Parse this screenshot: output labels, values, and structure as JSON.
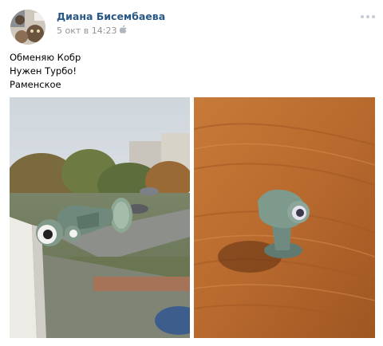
{
  "post": {
    "author_name": "Диана Бисембаева",
    "timestamp": "5 окт в 14:23",
    "device_icon": "apple-icon",
    "more_icon": "more-dots-icon",
    "text_lines": [
      "Обменяю Кобр",
      "Нужен Турбо!",
      "Раменское"
    ]
  },
  "colors": {
    "author_link": "#2a5885",
    "meta_text": "#939393",
    "toy_green": "#7d9a8c",
    "wood": "#b86a2e"
  }
}
